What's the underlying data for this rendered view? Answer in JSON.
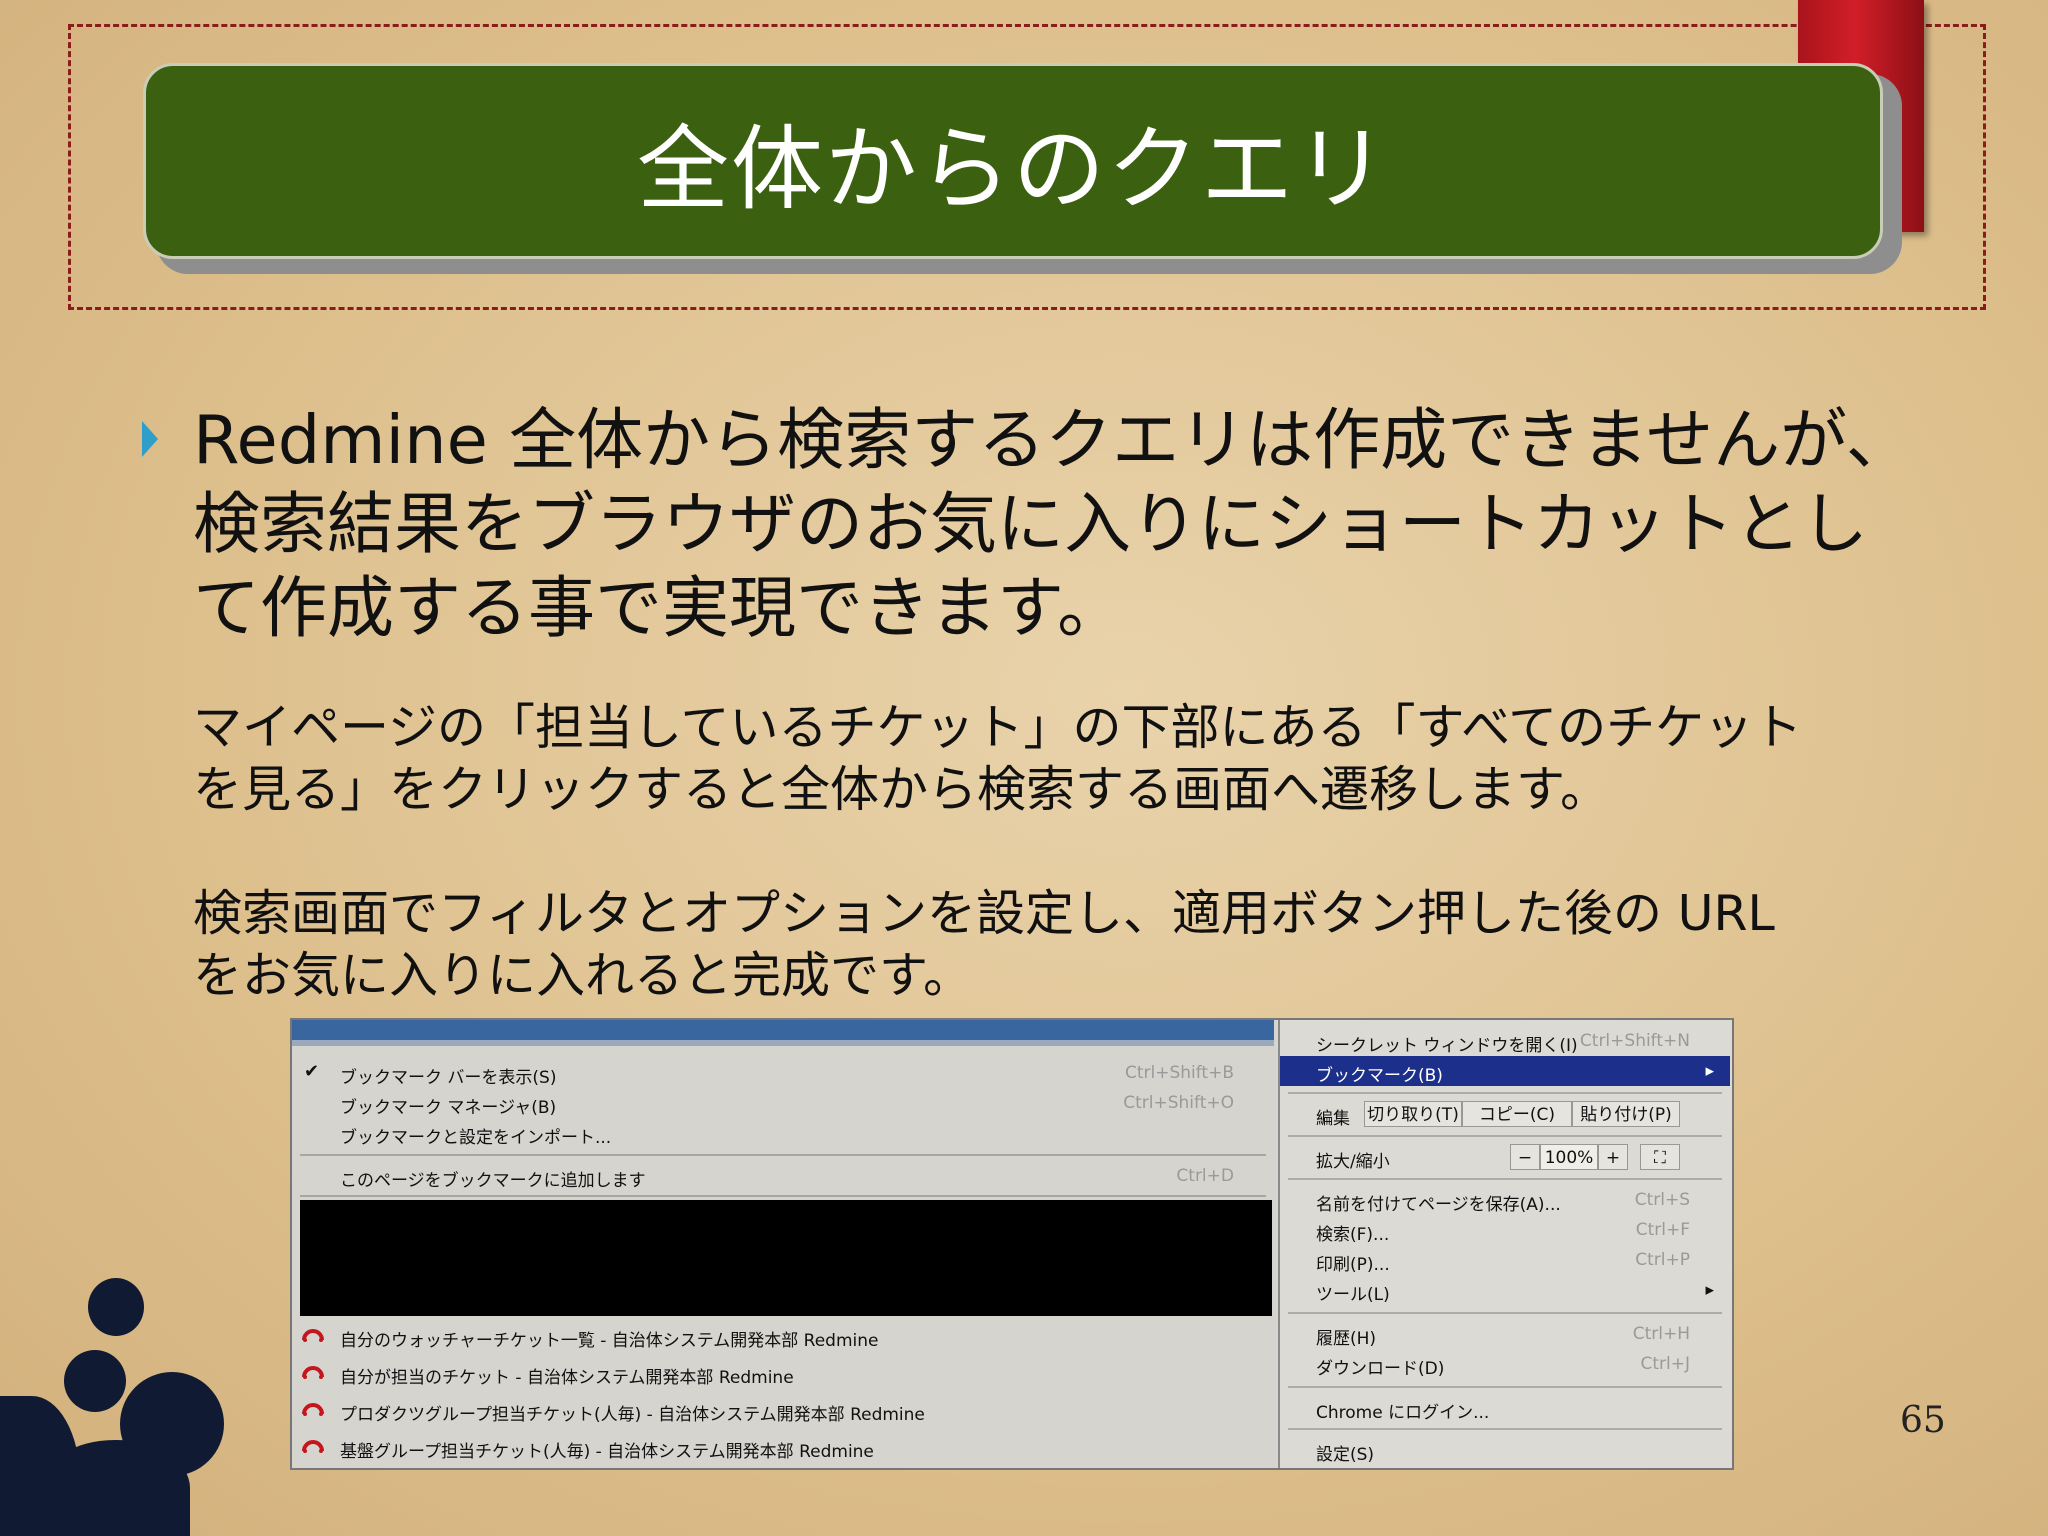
{
  "slide": {
    "title": "全体からのクエリ",
    "bullet": "Redmine 全体から検索するクエリは作成できませんが、検索結果をブラウザのお気に入りにショートカットとして作成する事で実現できます。",
    "paragraph1": "マイページの「担当しているチケット」の下部にある「すべてのチケット\nを見る」をクリックすると全体から検索する画面へ遷移します。",
    "paragraph2": "検索画面でフィルタとオプションを設定し、適用ボタン押した後の URL\nをお気に入りに入れると完成です。",
    "page_number": "65"
  },
  "bookmark_menu": {
    "items": [
      {
        "label": "ブックマーク バーを表示(S)",
        "shortcut": "Ctrl+Shift+B",
        "checked": "✔"
      },
      {
        "label": "ブックマーク マネージャ(B)",
        "shortcut": "Ctrl+Shift+O"
      },
      {
        "label": "ブックマークと設定をインポート..."
      },
      {
        "label": "このページをブックマークに追加します",
        "shortcut": "Ctrl+D"
      }
    ],
    "bookmarks": [
      "自分のウォッチャーチケット一覧 - 自治体システム開発本部 Redmine",
      "自分が担当のチケット - 自治体システム開発本部 Redmine",
      "プロダクツグループ担当チケット(人毎) - 自治体システム開発本部 Redmine",
      "基盤グループ担当チケット(人毎) - 自治体システム開発本部 Redmine"
    ]
  },
  "chrome_menu": {
    "incognito": {
      "label": "シークレット ウィンドウを開く(I)",
      "shortcut": "Ctrl+Shift+N"
    },
    "bookmarks": {
      "label": "ブックマーク(B)",
      "arrow": "▸"
    },
    "edit": {
      "label": "編集",
      "cut": "切り取り(T)",
      "copy": "コピー(C)",
      "paste": "貼り付け(P)"
    },
    "zoom": {
      "label": "拡大/縮小",
      "minus": "−",
      "value": "100%",
      "plus": "+",
      "fullscreen": "⛶"
    },
    "save": {
      "label": "名前を付けてページを保存(A)...",
      "shortcut": "Ctrl+S"
    },
    "find": {
      "label": "検索(F)...",
      "shortcut": "Ctrl+F"
    },
    "print": {
      "label": "印刷(P)...",
      "shortcut": "Ctrl+P"
    },
    "tools": {
      "label": "ツール(L)",
      "arrow": "▸"
    },
    "history": {
      "label": "履歴(H)",
      "shortcut": "Ctrl+H"
    },
    "downloads": {
      "label": "ダウンロード(D)",
      "shortcut": "Ctrl+J"
    },
    "signin": {
      "label": "Chrome にログイン..."
    },
    "settings": {
      "label": "設定(S)"
    }
  },
  "colors": {
    "title_bg": "#3b6010",
    "bullet": "#2f9fc9",
    "accent": "#8a1c1c",
    "menu_highlight": "#1c2f8a"
  }
}
